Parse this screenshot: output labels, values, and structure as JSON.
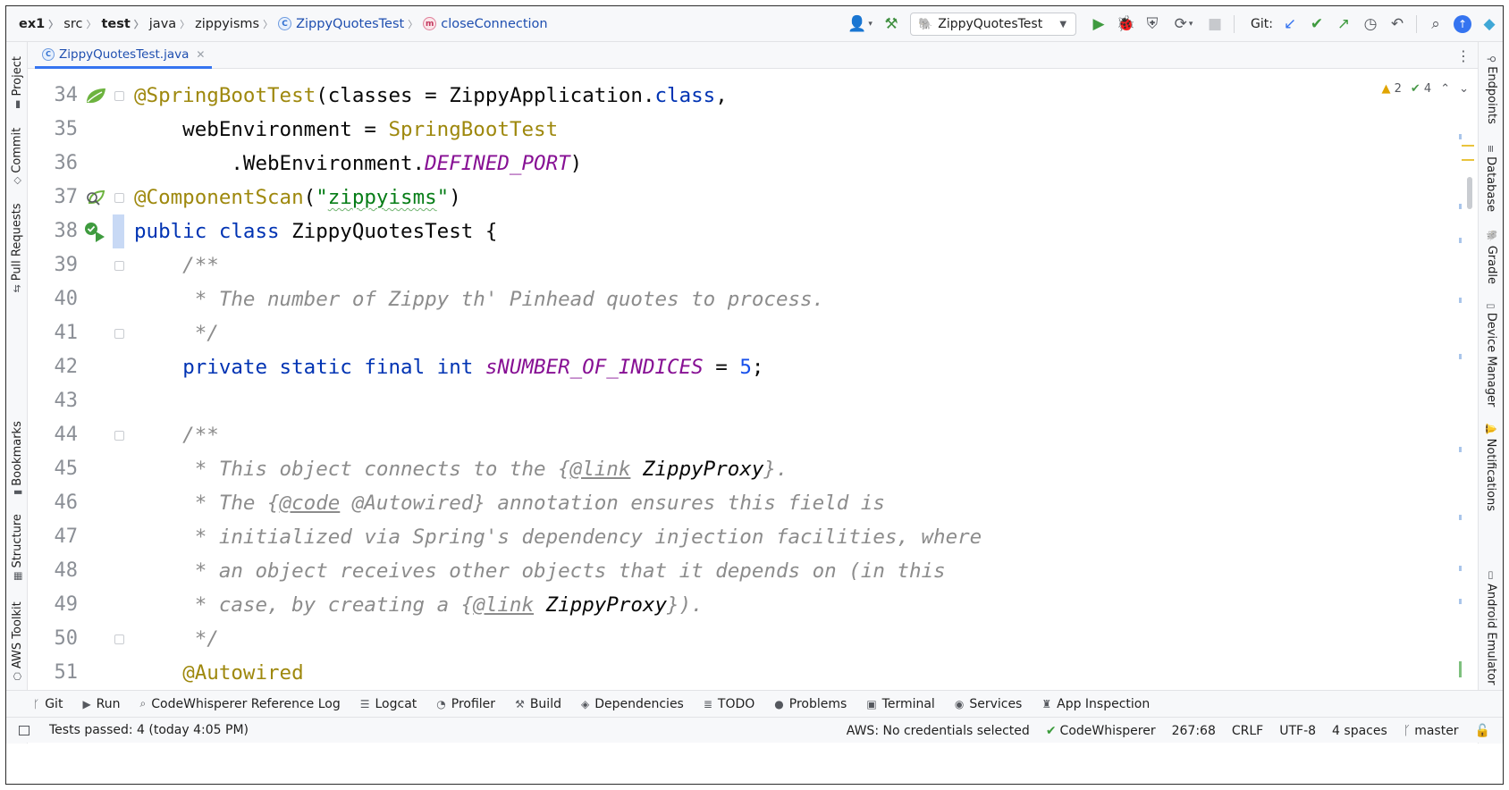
{
  "navbar": {
    "breadcrumbs": [
      "ex1",
      "src",
      "test",
      "java",
      "zippyisms",
      "ZippyQuotesTest",
      "closeConnection"
    ],
    "run_config": "ZippyQuotesTest",
    "git_label": "Git:"
  },
  "file_tab": {
    "label": "ZippyQuotesTest.java"
  },
  "left_tools": [
    "Project",
    "Commit",
    "Pull Requests",
    "Bookmarks",
    "Structure",
    "AWS Toolkit"
  ],
  "right_tools": [
    "Endpoints",
    "Database",
    "Gradle",
    "Device Manager",
    "Notifications",
    "Android Emulator"
  ],
  "inspections": {
    "warnings": "2",
    "weak_warnings": "4"
  },
  "code": {
    "line_numbers": [
      "34",
      "35",
      "36",
      "37",
      "38",
      "39",
      "40",
      "41",
      "42",
      "43",
      "44",
      "45",
      "46",
      "47",
      "48",
      "49",
      "50",
      "51"
    ],
    "l34": {
      "ann": "@SpringBootTest",
      "a": "(classes = ZippyApplication.",
      "kw": "class",
      "b": ","
    },
    "l35": {
      "a": "    webEnvironment = ",
      "ann": "SpringBootTest"
    },
    "l36": {
      "a": "        .WebEnvironment.",
      "konst": "DEFINED_PORT",
      "b": ")"
    },
    "l37": {
      "ann": "@ComponentScan",
      "a": "(",
      "str1": "\"",
      "str2": "zippyisms",
      "str3": "\"",
      "b": ")"
    },
    "l38": {
      "kw1": "public",
      "kw2": "class",
      "rest": " ZippyQuotesTest {"
    },
    "l39": "    /**",
    "l40": "     * The number of Zippy th' Pinhead quotes to process.",
    "l41": "     */",
    "l42": {
      "indent": "    ",
      "kw": "private static final int",
      "konst": "sNUMBER_OF_INDICES",
      "a": " = ",
      "num": "5",
      "b": ";"
    },
    "l44": "    /**",
    "l45": {
      "a": "     * This object connects to the {",
      "tag": "@link",
      "ref": " ZippyProxy",
      "b": "}."
    },
    "l46": {
      "a": "     * The {",
      "tag": "@code",
      "b": " @Autowired} annotation ensures this field is"
    },
    "l47": "     * initialized via Spring's dependency injection facilities, where",
    "l48": "     * an object receives other objects that it depends on (in this",
    "l49": {
      "a": "     * case, by creating a {",
      "tag": "@link",
      "ref": " ZippyProxy",
      "b": "})."
    },
    "l50": "     */",
    "l51": {
      "indent": "    ",
      "ann": "@Autowired"
    }
  },
  "tool_windows": [
    "Git",
    "Run",
    "CodeWhisperer Reference Log",
    "Logcat",
    "Profiler",
    "Build",
    "Dependencies",
    "TODO",
    "Problems",
    "Terminal",
    "Services",
    "App Inspection"
  ],
  "status": {
    "message": "Tests passed: 4 (today 4:05 PM)",
    "aws": "AWS: No credentials selected",
    "codewhisperer": "CodeWhisperer",
    "position": "267:68",
    "line_sep": "CRLF",
    "encoding": "UTF-8",
    "indent": "4 spaces",
    "branch": "master"
  },
  "colors": {
    "accent": "#3574f0",
    "keyword": "#0033b3",
    "annotation": "#9e880d",
    "string": "#067d17",
    "constant": "#871094",
    "comment": "#8c8c8c",
    "number": "#1750eb"
  }
}
